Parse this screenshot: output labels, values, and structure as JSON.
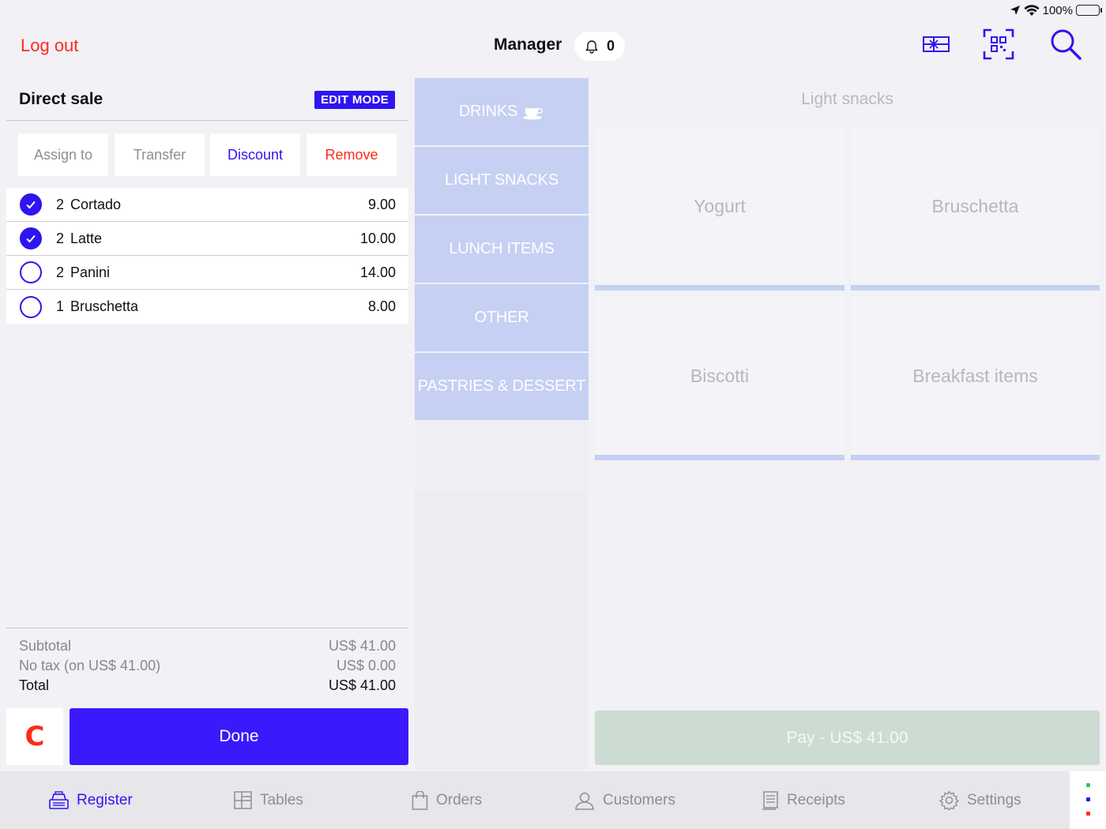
{
  "status_bar": {
    "battery": "100%"
  },
  "header": {
    "logout_label": "Log out",
    "user_label": "Manager",
    "notification_count": "0",
    "icons": [
      "gift-card-icon",
      "qr-scan-icon",
      "search-icon"
    ]
  },
  "order": {
    "title": "Direct sale",
    "mode_badge": "EDIT MODE",
    "actions": {
      "assign": "Assign to",
      "transfer": "Transfer",
      "discount": "Discount",
      "remove": "Remove"
    },
    "items": [
      {
        "qty": "2",
        "name": "Cortado",
        "price": "9.00",
        "selected": true
      },
      {
        "qty": "2",
        "name": "Latte",
        "price": "10.00",
        "selected": true
      },
      {
        "qty": "2",
        "name": "Panini",
        "price": "14.00",
        "selected": false
      },
      {
        "qty": "1",
        "name": "Bruschetta",
        "price": "8.00",
        "selected": false
      }
    ],
    "subtotal_label": "Subtotal",
    "subtotal_value": "US$ 41.00",
    "tax_label": "No tax (on US$ 41.00)",
    "tax_value": "US$ 0.00",
    "total_label": "Total",
    "total_value": "US$ 41.00",
    "clear_label": "C",
    "done_label": "Done"
  },
  "categories": [
    {
      "label": "DRINKS",
      "icon": "coffee-cup-icon"
    },
    {
      "label": "LIGHT SNACKS"
    },
    {
      "label": "LUNCH ITEMS"
    },
    {
      "label": "OTHER"
    },
    {
      "label": "PASTRIES & DESSERT"
    }
  ],
  "products": {
    "section_title": "Light snacks",
    "tiles": [
      "Yogurt",
      "Bruschetta",
      "Biscotti",
      "Breakfast items"
    ]
  },
  "pay_label": "Pay - US$ 41.00",
  "tabs": [
    {
      "label": "Register",
      "icon": "register-icon",
      "active": true
    },
    {
      "label": "Tables",
      "icon": "tables-icon"
    },
    {
      "label": "Orders",
      "icon": "orders-bag-icon"
    },
    {
      "label": "Customers",
      "icon": "customers-icon"
    },
    {
      "label": "Receipts",
      "icon": "receipts-icon"
    },
    {
      "label": "Settings",
      "icon": "settings-gear-icon"
    }
  ],
  "colors": {
    "accent": "#2f15f0",
    "danger": "#ff2a1a",
    "category_bg": "#c5d0f3",
    "pay_bg": "#ccdcd2"
  }
}
